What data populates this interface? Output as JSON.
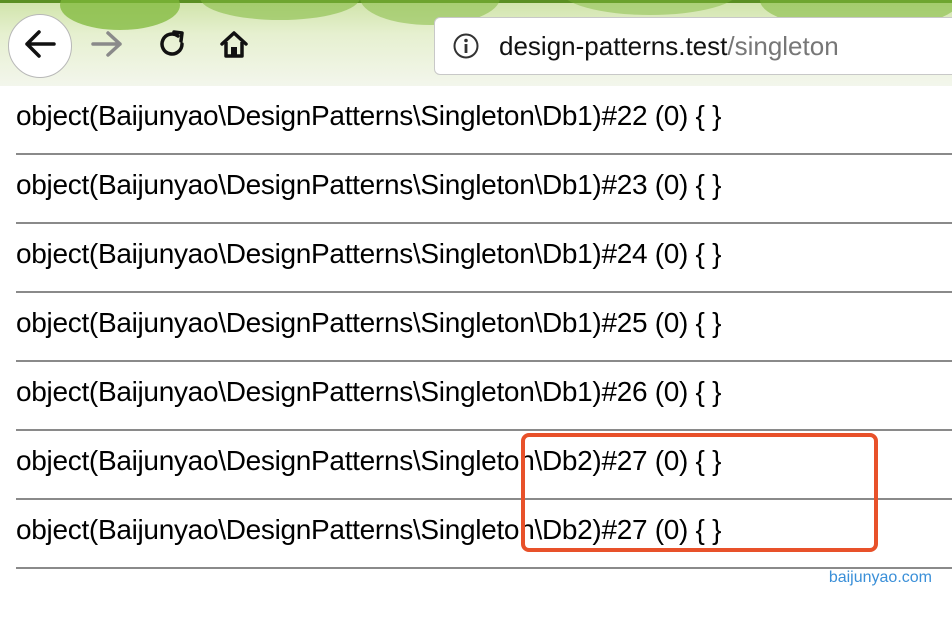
{
  "browser": {
    "url_host": "design-patterns.test",
    "url_path": "/singleton",
    "icons": {
      "back": "back-arrow-icon",
      "forward": "forward-arrow-icon",
      "reload": "reload-icon",
      "home": "home-icon",
      "info": "info-circle-icon"
    }
  },
  "output_lines": [
    "object(Baijunyao\\DesignPatterns\\Singleton\\Db1)#22 (0) { }",
    "object(Baijunyao\\DesignPatterns\\Singleton\\Db1)#23 (0) { }",
    "object(Baijunyao\\DesignPatterns\\Singleton\\Db1)#24 (0) { }",
    "object(Baijunyao\\DesignPatterns\\Singleton\\Db1)#25 (0) { }",
    "object(Baijunyao\\DesignPatterns\\Singleton\\Db1)#26 (0) { }",
    "object(Baijunyao\\DesignPatterns\\Singleton\\Db2)#27 (0) { }",
    "object(Baijunyao\\DesignPatterns\\Singleton\\Db2)#27 (0) { }"
  ],
  "watermark": "baijunyao.com",
  "colors": {
    "highlight_border": "#e8512a",
    "watermark": "#3a8fd8"
  }
}
